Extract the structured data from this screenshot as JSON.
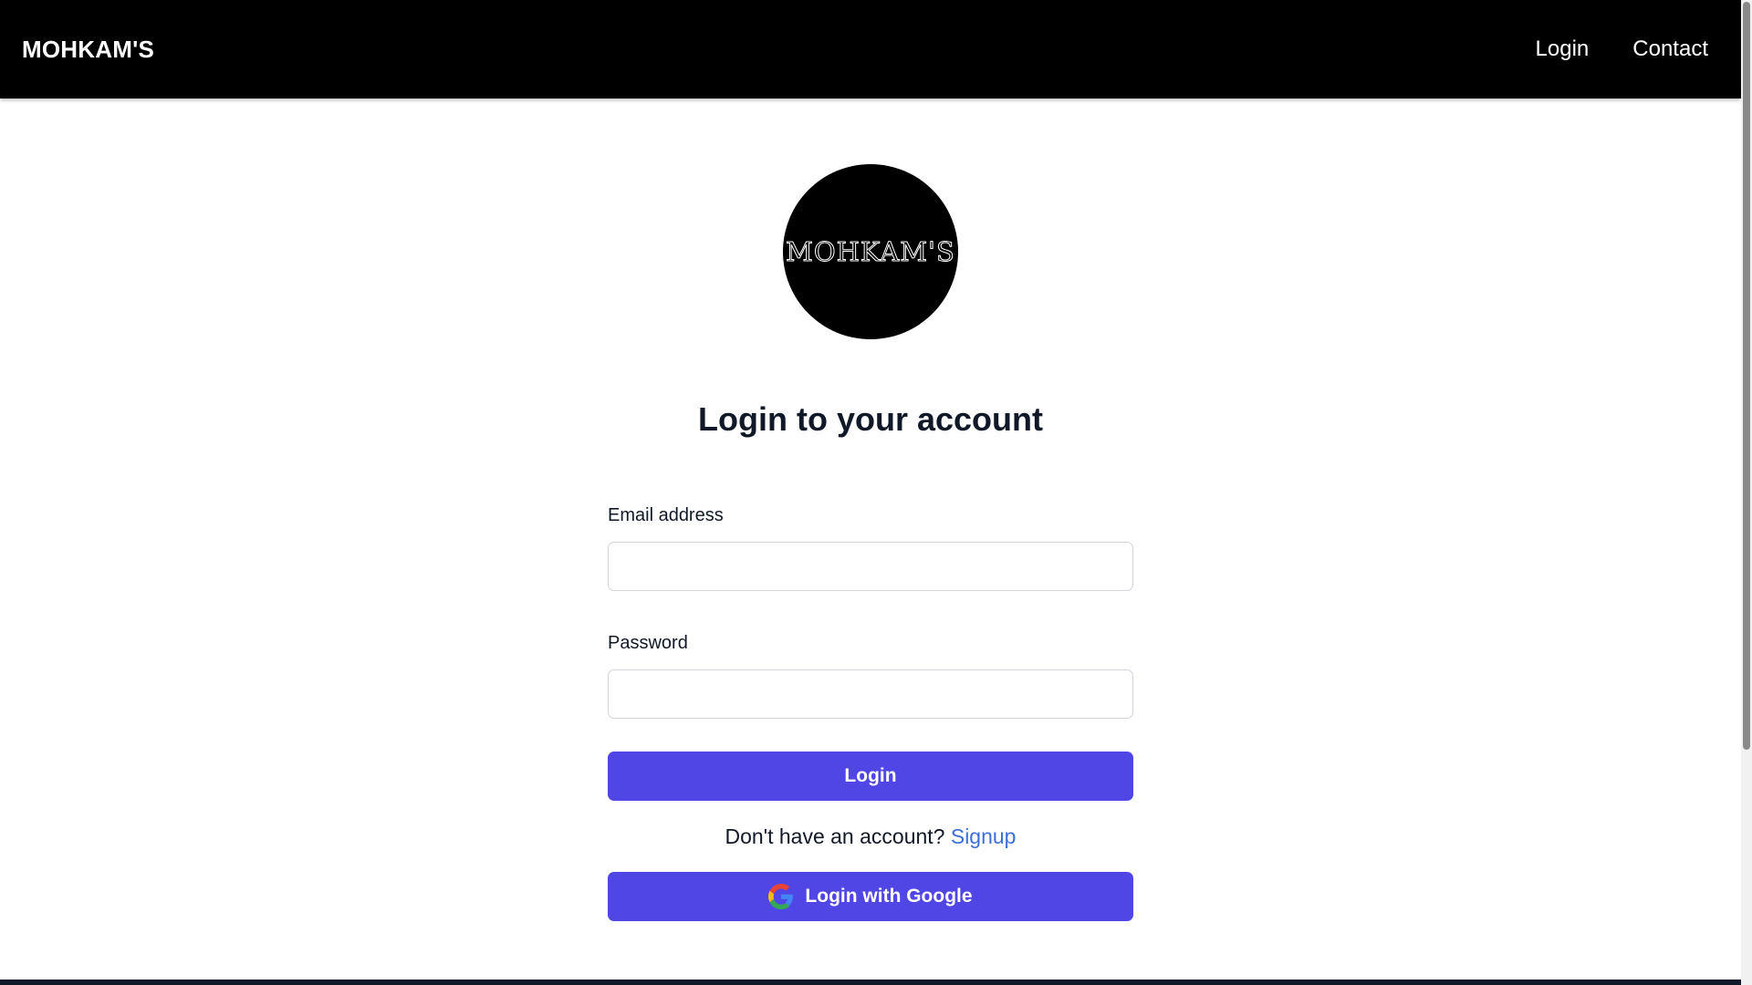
{
  "navbar": {
    "brand": "MOHKAM'S",
    "links": [
      "Login",
      "Contact"
    ]
  },
  "logo": {
    "text": "MOHKAM'S"
  },
  "form": {
    "title": "Login to your account",
    "email_label": "Email address",
    "email_value": "",
    "password_label": "Password",
    "password_value": "",
    "login_button": "Login",
    "signup_prompt": "Don't have an account?",
    "signup_link": "Signup",
    "google_button": "Login with Google"
  },
  "colors": {
    "navbar_bg": "#000000",
    "primary_button": "#4f46e5",
    "link": "#3b6fd6",
    "heading": "#111827"
  },
  "icons": {
    "google": "google-icon"
  }
}
